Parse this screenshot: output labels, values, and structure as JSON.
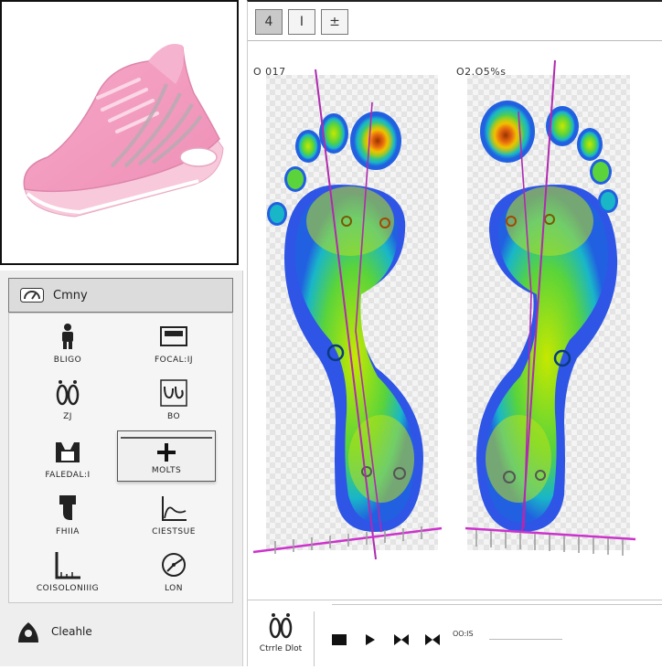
{
  "left_panel": {
    "header_label": "Cmny",
    "tools": [
      {
        "icon": "person-icon",
        "label": "BLIGO"
      },
      {
        "icon": "frame-icon",
        "label": "FOCAL:IJ"
      },
      {
        "icon": "footprints-icon",
        "label": "ZJ"
      },
      {
        "icon": "wave-box-icon",
        "label": "BO"
      },
      {
        "icon": "shoe-outline-icon",
        "label": "FALEDAL:I"
      },
      {
        "icon": "plus-icon",
        "label": "MOLTS"
      },
      {
        "icon": "ankle-icon",
        "label": "FHIIA"
      },
      {
        "icon": "curve-chart-icon",
        "label": "CIESTSUE"
      },
      {
        "icon": "ruler-icon",
        "label": "COISOLONIIIG"
      },
      {
        "icon": "dial-icon",
        "label": "LON"
      }
    ],
    "footer_label": "Cleahle"
  },
  "viewer": {
    "toolbar": [
      "4",
      "I",
      "±"
    ],
    "left_foot_label": "O 017",
    "right_foot_label": "O2.O5%s",
    "bottom_label": "Ctrrle Dlot",
    "playback_label": "OO:IS"
  }
}
